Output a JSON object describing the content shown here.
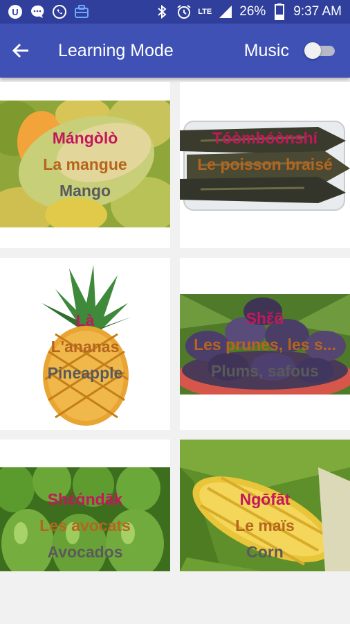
{
  "status_bar": {
    "icons_left": [
      "app-u-icon",
      "chat-bubble-icon",
      "whatsapp-icon",
      "briefcase-icon"
    ],
    "network": "LTE",
    "battery": "26%",
    "time": "9:37 AM"
  },
  "app_bar": {
    "title": "Learning Mode",
    "music_label": "Music",
    "music_on": false
  },
  "colors": {
    "status_bar": "#2f3f9b",
    "app_bar": "#3f51b5",
    "local_word": "#c2185b",
    "french_word": "#b5651d",
    "english_word": "#5a5a5a"
  },
  "items": [
    {
      "local": "Mángòlò",
      "french": "La mangue",
      "english": "Mango"
    },
    {
      "local": "Tóòmbóònshí",
      "french": "Le poisson braisé",
      "english": ""
    },
    {
      "local": "Là",
      "french": "L'ananas",
      "english": "Pineapple"
    },
    {
      "local": "Shɛ̌ɑ̄",
      "french": "Les prunes, les s...",
      "english": "Plums, safous"
    },
    {
      "local": "Shɛ́ɑ́ndāk",
      "french": "Les avocats",
      "english": "Avocados"
    },
    {
      "local": "Ngōfāt",
      "french": "Le maïs",
      "english": "Corn"
    }
  ]
}
